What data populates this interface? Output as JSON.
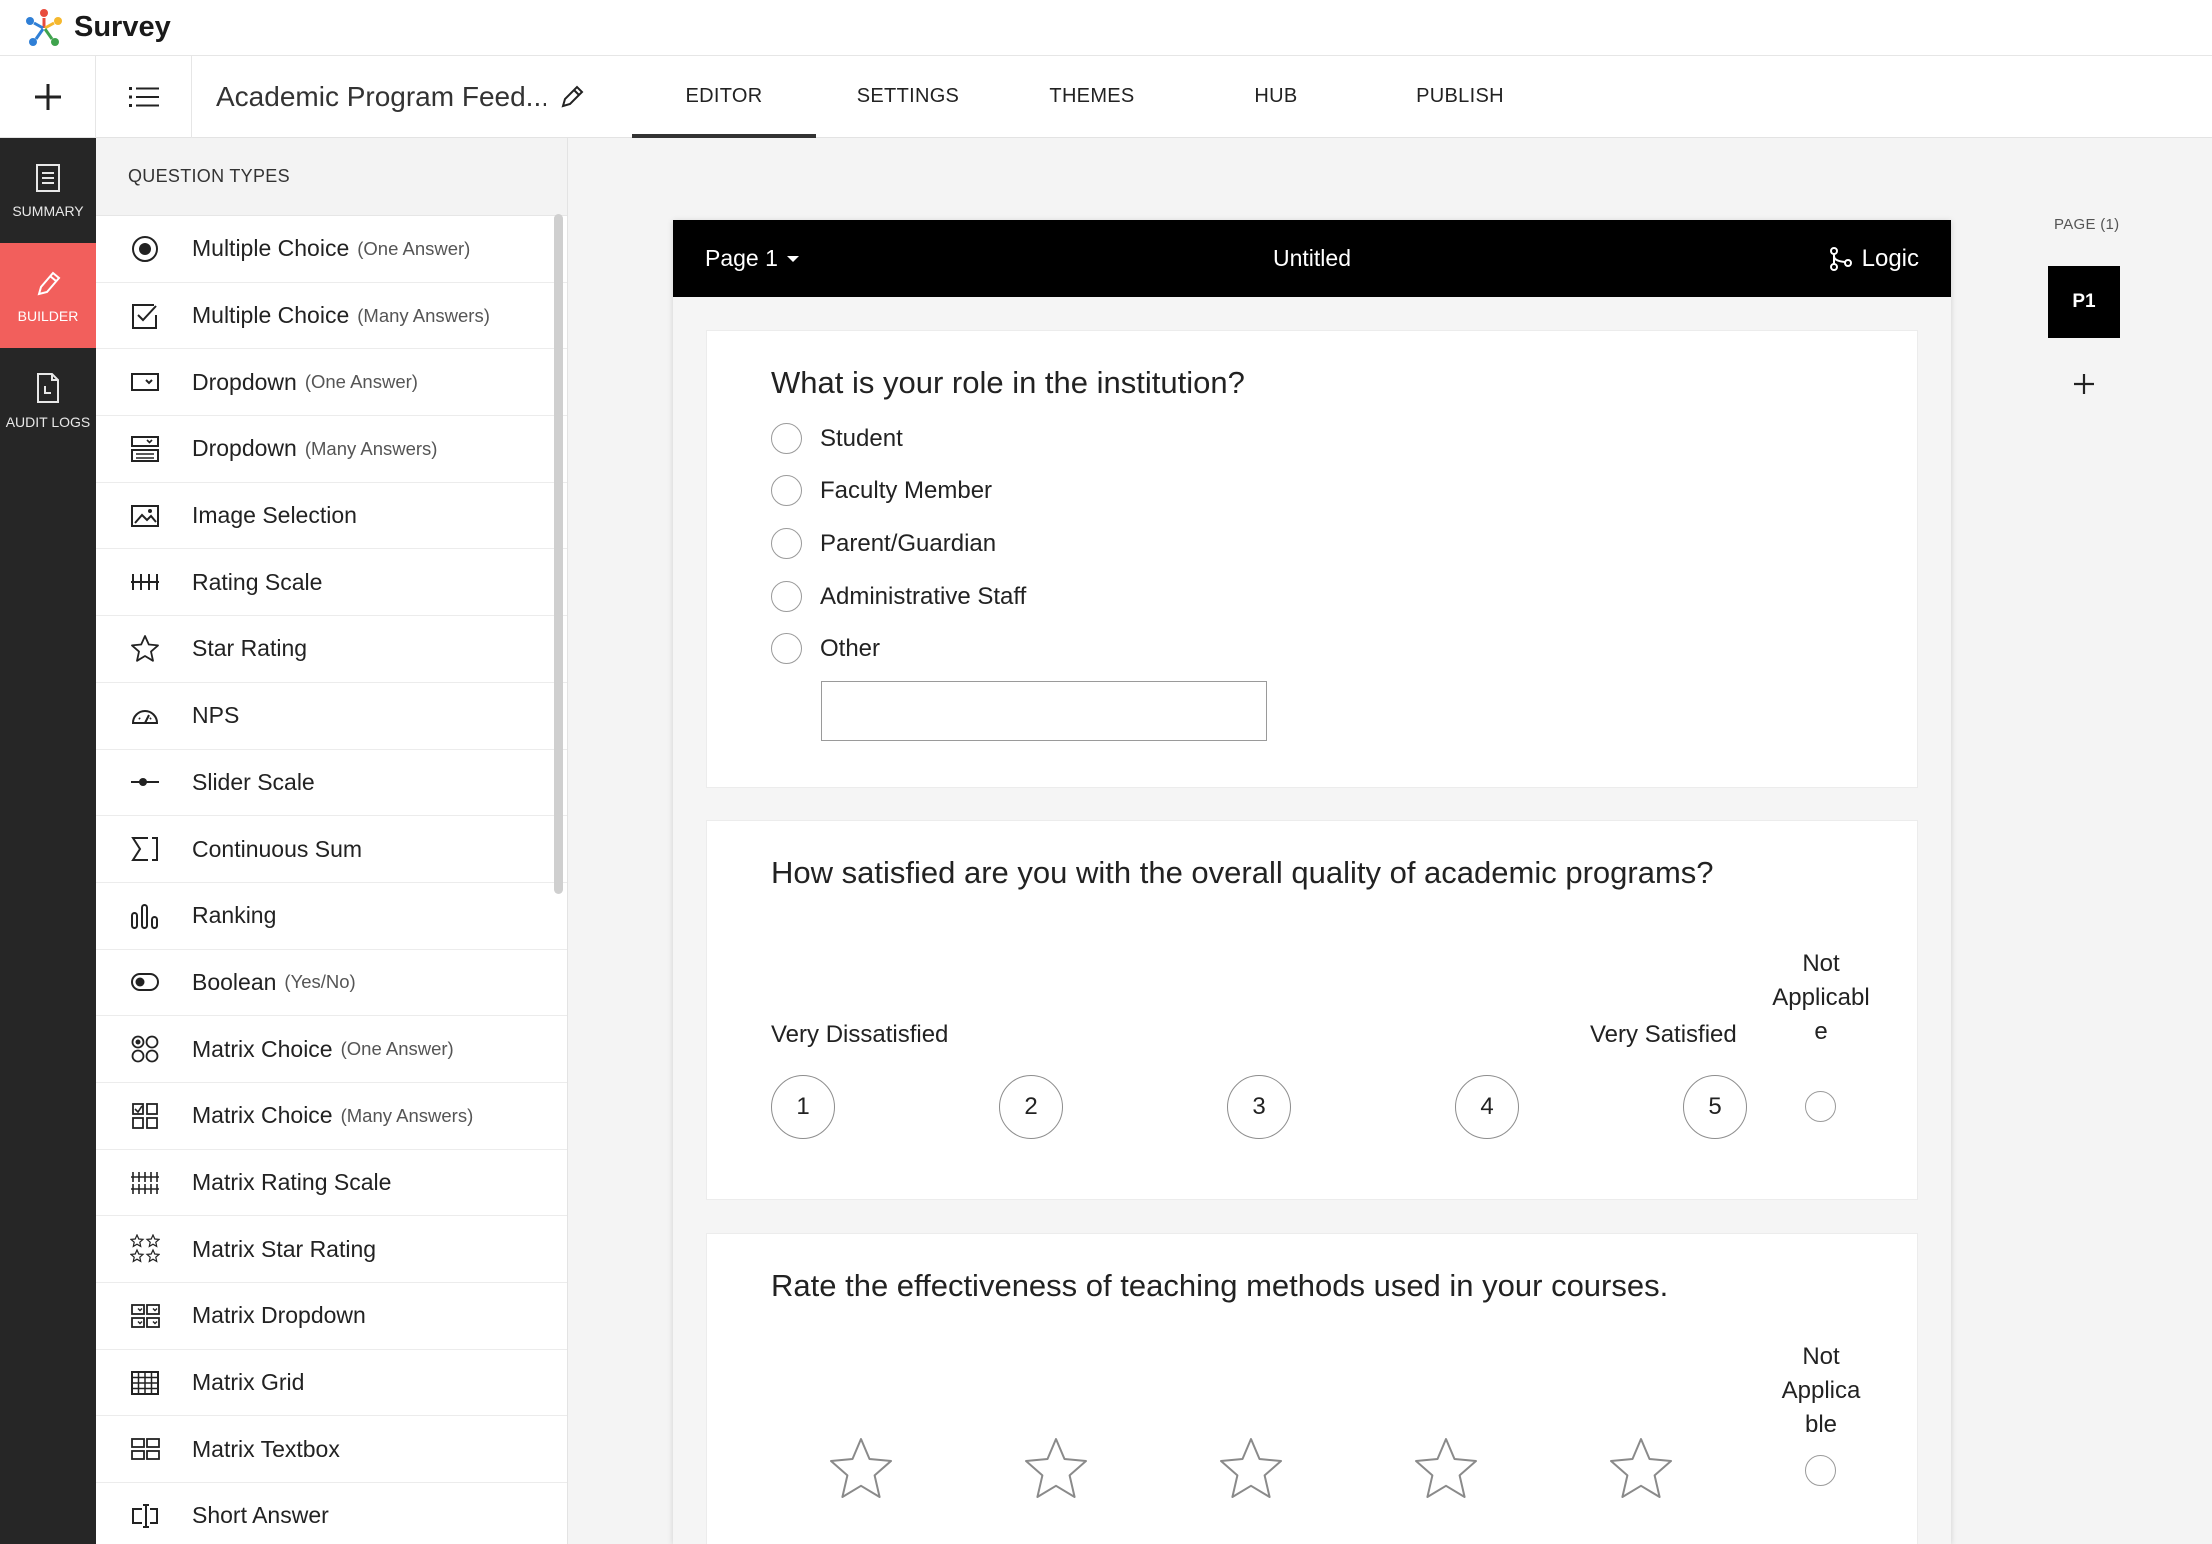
{
  "brand": {
    "name": "Survey"
  },
  "toolbar": {
    "survey_title": "Academic Program Feed...",
    "tabs": [
      {
        "label": "EDITOR",
        "active": true
      },
      {
        "label": "SETTINGS"
      },
      {
        "label": "THEMES"
      },
      {
        "label": "HUB"
      },
      {
        "label": "PUBLISH"
      }
    ]
  },
  "rail": {
    "items": [
      {
        "label": "SUMMARY",
        "icon": "summary-icon"
      },
      {
        "label": "BUILDER",
        "icon": "pencil-icon",
        "active": true
      },
      {
        "label": "AUDIT LOGS",
        "icon": "audit-log-icon"
      }
    ]
  },
  "question_types": {
    "header": "QUESTION TYPES",
    "items": [
      {
        "label": "Multiple Choice",
        "sub": "(One Answer)",
        "icon": "radio-icon"
      },
      {
        "label": "Multiple Choice",
        "sub": "(Many Answers)",
        "icon": "checkbox-icon"
      },
      {
        "label": "Dropdown",
        "sub": "(One Answer)",
        "icon": "dropdown-icon"
      },
      {
        "label": "Dropdown",
        "sub": "(Many Answers)",
        "icon": "multi-dropdown-icon"
      },
      {
        "label": "Image Selection",
        "sub": "",
        "icon": "image-icon"
      },
      {
        "label": "Rating Scale",
        "sub": "",
        "icon": "rating-scale-icon"
      },
      {
        "label": "Star Rating",
        "sub": "",
        "icon": "star-icon"
      },
      {
        "label": "NPS",
        "sub": "",
        "icon": "gauge-icon"
      },
      {
        "label": "Slider Scale",
        "sub": "",
        "icon": "slider-icon"
      },
      {
        "label": "Continuous Sum",
        "sub": "",
        "icon": "sigma-icon"
      },
      {
        "label": "Ranking",
        "sub": "",
        "icon": "ranking-icon"
      },
      {
        "label": "Boolean",
        "sub": "(Yes/No)",
        "icon": "toggle-icon"
      },
      {
        "label": "Matrix Choice",
        "sub": "(One Answer)",
        "icon": "matrix-radio-icon"
      },
      {
        "label": "Matrix Choice",
        "sub": "(Many Answers)",
        "icon": "matrix-checkbox-icon"
      },
      {
        "label": "Matrix Rating Scale",
        "sub": "",
        "icon": "matrix-rating-icon"
      },
      {
        "label": "Matrix Star Rating",
        "sub": "",
        "icon": "matrix-star-icon"
      },
      {
        "label": "Matrix Dropdown",
        "sub": "",
        "icon": "matrix-dropdown-icon"
      },
      {
        "label": "Matrix Grid",
        "sub": "",
        "icon": "grid-icon"
      },
      {
        "label": "Matrix Textbox",
        "sub": "",
        "icon": "matrix-textbox-icon"
      },
      {
        "label": "Short Answer",
        "sub": "",
        "icon": "short-answer-icon"
      }
    ]
  },
  "page": {
    "selector": "Page 1",
    "title": "Untitled",
    "logic_label": "Logic"
  },
  "q1": {
    "title": "What is your role in the institution?",
    "options": [
      "Student",
      "Faculty Member",
      "Parent/Guardian",
      "Administrative Staff",
      "Other"
    ]
  },
  "q2": {
    "title": "How satisfied are you with the overall quality of academic programs?",
    "low_label": "Very Dissatisfied",
    "high_label": "Very Satisfied",
    "na_lines": [
      "Not",
      "Applicabl",
      "e"
    ],
    "scale": [
      "1",
      "2",
      "3",
      "4",
      "5"
    ]
  },
  "q3": {
    "title": "Rate the effectiveness of teaching methods used in your courses.",
    "na_lines": [
      "Not",
      "Applica",
      "ble"
    ],
    "stars": 5
  },
  "pages_panel": {
    "label": "PAGE (1)",
    "current": "P1"
  }
}
